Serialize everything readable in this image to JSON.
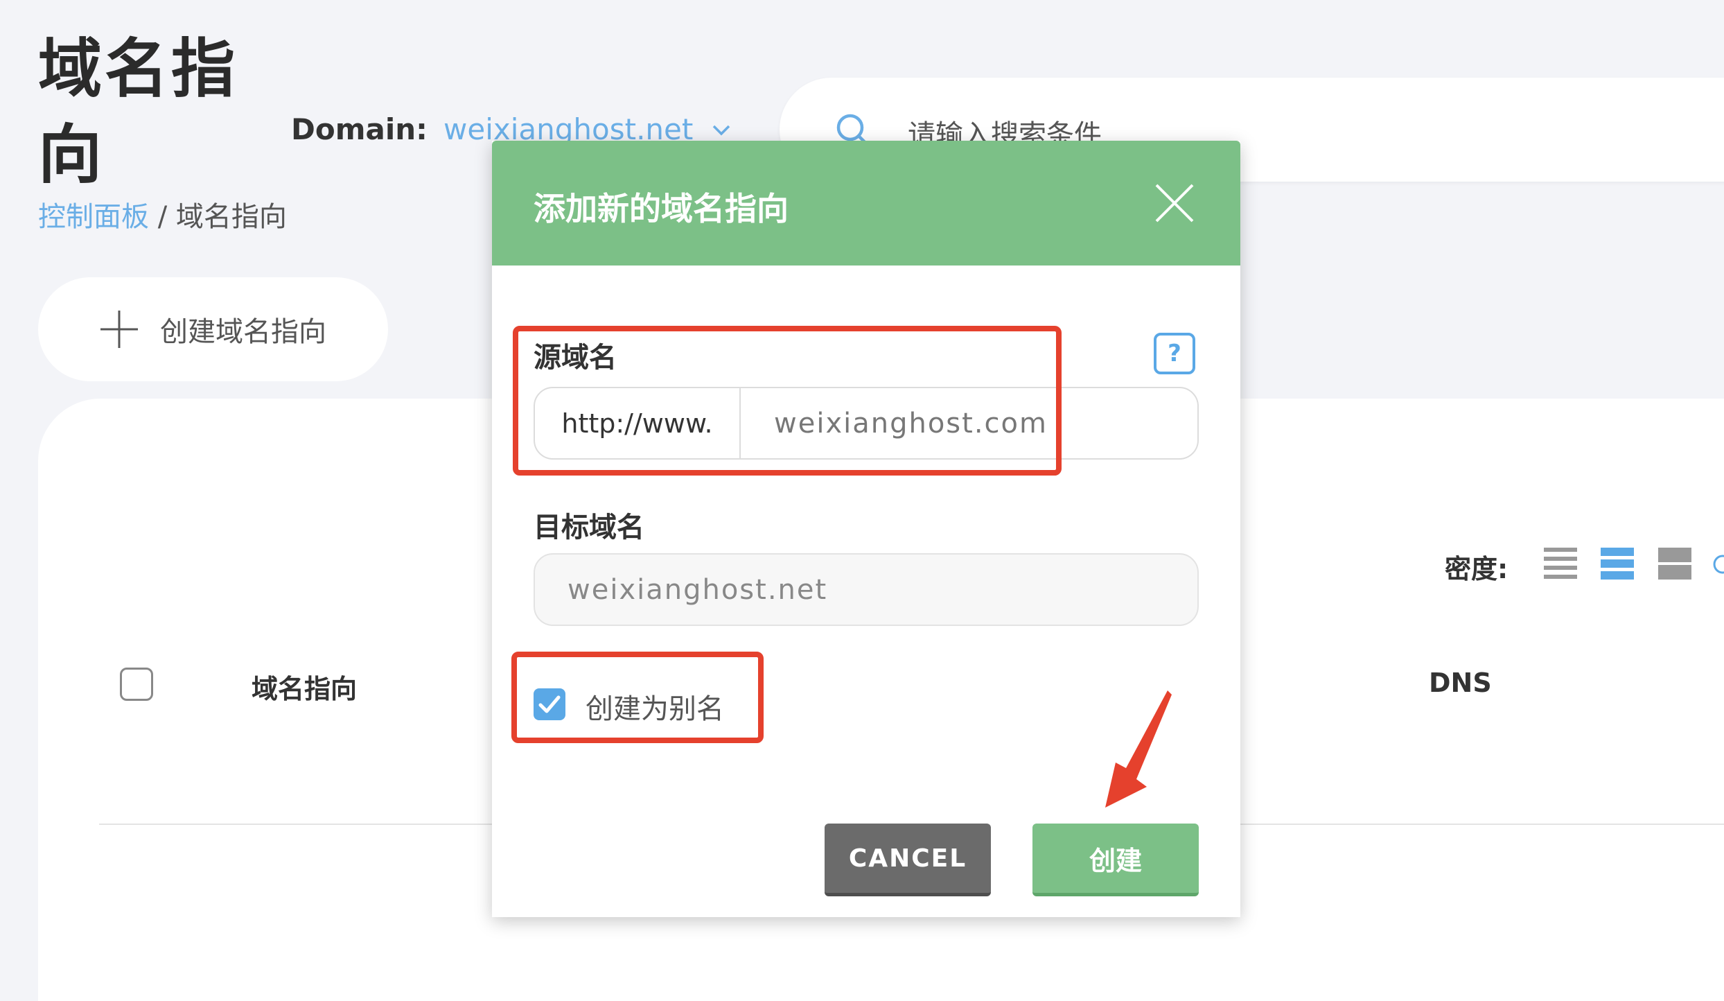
{
  "page": {
    "title": "域名指向",
    "domain_label": "Domain:",
    "domain_value": "weixianghost.net",
    "search_placeholder": "请输入搜索条件",
    "breadcrumb": {
      "home": "控制面板",
      "separator": " / ",
      "current": "域名指向"
    },
    "create_button": "创建域名指向"
  },
  "table": {
    "density_label": "密度:",
    "columns": [
      "域名指向",
      "DNS"
    ]
  },
  "modal": {
    "title": "添加新的域名指向",
    "help_icon": "?",
    "source_label": "源域名",
    "source_prefix": "http://www.",
    "source_value": "weixianghost.com",
    "target_label": "目标域名",
    "target_placeholder": "weixianghost.net",
    "alias_checked": true,
    "alias_label": "创建为别名",
    "cancel_label": "CANCEL",
    "confirm_label": "创建"
  },
  "colors": {
    "modal_header": "#7cc087",
    "link": "#6aaee6",
    "annotation_red": "#e5412d",
    "cancel_button": "#6b6b6b"
  },
  "icons": [
    "chevron-down-icon",
    "search-icon",
    "plus-icon",
    "close-icon",
    "help-icon",
    "check-icon",
    "density-compact-icon",
    "density-default-icon",
    "density-comfortable-icon",
    "refresh-icon",
    "annotation-arrow-icon"
  ]
}
